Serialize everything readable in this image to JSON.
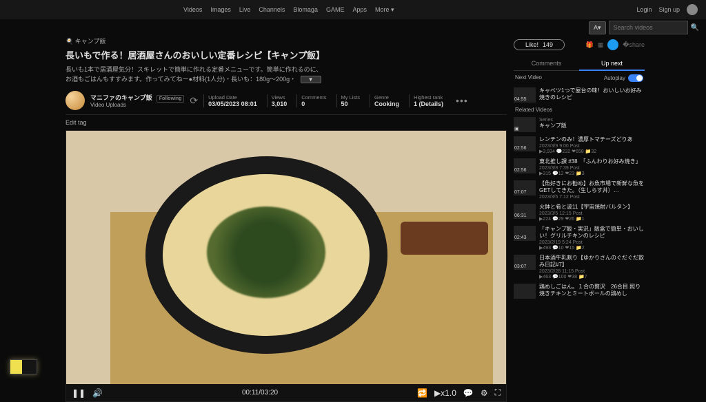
{
  "nav": {
    "items": [
      "Videos",
      "Images",
      "Live",
      "Channels",
      "Blomaga",
      "GAME",
      "Apps",
      "More ▾"
    ],
    "login": "Login",
    "signup": "Sign up"
  },
  "search": {
    "placeholder": "Search videos",
    "langBtn": "A▾"
  },
  "breadcrumb": "🍳 キャンプ飯",
  "title": "長いもで作る！居酒屋さんのおいしい定番レシピ【キャンプ飯】",
  "desc_line1": "長いも1本で居酒屋気分！スキレットで簡単に作れる定番メニューです。簡単に作れるのに、",
  "desc_line2": "お酒もごはんもすすみます。作ってみてねー●材料(1人分)・長いも：180g～200g・",
  "readmore": "▼",
  "uploader": {
    "name": "マニファのキャンプ飯",
    "sub": "Video Uploads",
    "following": "Following"
  },
  "stats": [
    {
      "label": "Upload Date",
      "value": "03/05/2023 08:01"
    },
    {
      "label": "Views",
      "value": "3,010"
    },
    {
      "label": "Comments",
      "value": "0"
    },
    {
      "label": "My Lists",
      "value": "50"
    },
    {
      "label": "Genre",
      "value": "Cooking"
    },
    {
      "label": "Highest rank",
      "value": "1  (Details)"
    }
  ],
  "edit_tag": "Edit tag",
  "player": {
    "time": "00:11/03:20",
    "speed": "▶x1.0"
  },
  "side": {
    "like": "Like!",
    "like_count": "149",
    "tabs": [
      "Comments",
      "Up next"
    ],
    "next_label": "Next Video",
    "autoplay": "Autoplay",
    "next_item": {
      "title": "キャベツ1つで屋台の味！おいしいお好み焼きのレシピ",
      "dur": "04:55"
    },
    "related_header": "Related Videos",
    "series": {
      "label": "Series",
      "name": "キャンプ飯"
    },
    "items": [
      {
        "title": "レンチンのみ！濃厚トマチーズどりあ",
        "date": "2023/3/9 9:00 Post",
        "stats": "▶3,934 💬232 ❤658 📁32",
        "dur": "02:56"
      },
      {
        "title": "東北推し課 #38　「ふんわりお好み焼き」",
        "date": "2023/3/8 7:39 Post",
        "stats": "▶315 💬12 ❤23 📁3",
        "dur": "02:56"
      },
      {
        "title": "【魚好きにお勧め】お魚市場で新鮮な魚をGETしてきた。（生しらす丼）…",
        "date": "2023/3/5 7:12 Post",
        "stats": "",
        "dur": "07:07"
      },
      {
        "title": "火鉢と肴と波11【宇宙焼酎バルタン】",
        "date": "2023/3/5 12:15 Post",
        "stats": "▶224 💬29 ❤26 📁1",
        "dur": "06:31"
      },
      {
        "title": "「キャンプ飯・実況」飯盒で簡単・おいしい！グリルチキンのレシピ",
        "date": "2023/2/19 5:24 Post",
        "stats": "▶493 💬10 ❤15 📁2",
        "dur": "02:43"
      },
      {
        "title": "日本酒牛乳割り【ゆかりさんのぐだぐだ飲み日記#7】",
        "date": "2023/2/28 11:15 Post",
        "stats": "▶463 💬100 ❤38 📁7",
        "dur": "03:07"
      },
      {
        "title": "鶏めしごはん。１合の贅沢　26合目 照り焼きチキンとミートボールの鶏めし",
        "date": "",
        "stats": "",
        "dur": ""
      }
    ]
  }
}
